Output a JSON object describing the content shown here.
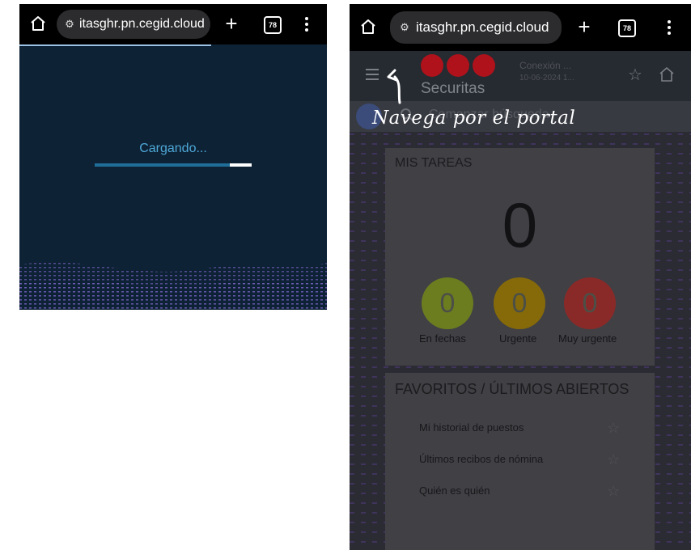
{
  "colors": {
    "chrome_bg": "#000000",
    "loading_bg": "#0e2236",
    "loading_text": "#4da8d6",
    "progress_track": "#1f6e97",
    "progress_fill": "#ffffff",
    "brand_red": "#b0121b",
    "green": "#6b7d1f",
    "amber": "#866a09",
    "red": "#8a2a28"
  },
  "left_screen": {
    "browser": {
      "url": "itasghr.pn.cegid.cloud",
      "tab_count": "78",
      "icons": [
        "home-icon",
        "site-settings-icon",
        "plus-icon",
        "tabs-icon",
        "menu-icon"
      ]
    },
    "loading_text": "Cargando...",
    "progress": 0.86
  },
  "right_screen": {
    "browser": {
      "url": "itasghr.pn.cegid.cloud",
      "tab_count": "78"
    },
    "header": {
      "brand": "Securitas",
      "connection_label": "Conexión ...",
      "connection_date": "10-06-2024 1..."
    },
    "search": {
      "placeholder": "Comenzar búsqueda"
    },
    "annotation": "Navega por el portal",
    "tasks": {
      "title": "MIS TAREAS",
      "total": "0",
      "buckets": [
        {
          "label": "En fechas",
          "count": "0"
        },
        {
          "label": "Urgente",
          "count": "0"
        },
        {
          "label": "Muy urgente",
          "count": "0"
        }
      ]
    },
    "favorites": {
      "title": "FAVORITOS / ÚLTIMOS ABIERTOS",
      "items": [
        {
          "label": "Mi historial de puestos"
        },
        {
          "label": "Últimos recibos de nómina"
        },
        {
          "label": "Quién es quién"
        }
      ]
    }
  }
}
